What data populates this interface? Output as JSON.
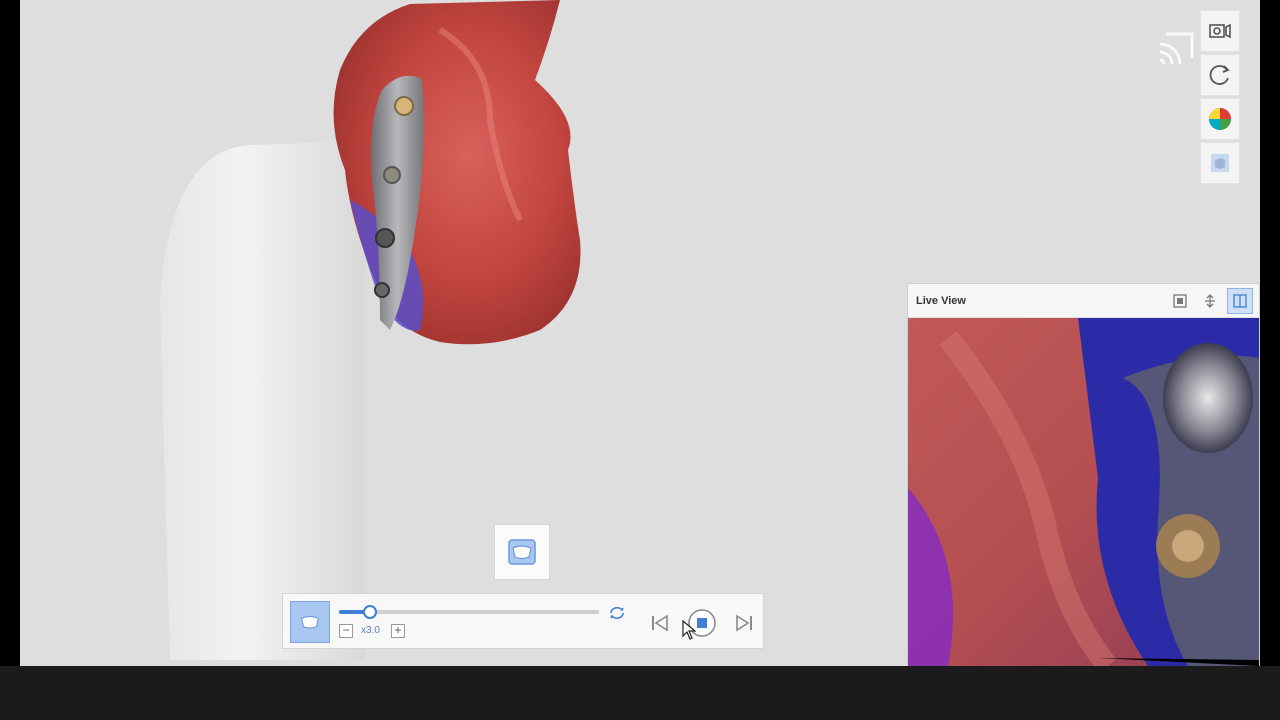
{
  "live_view": {
    "title": "Live View"
  },
  "playback": {
    "speed_label": "x3.0",
    "minus_label": "−",
    "plus_label": "+",
    "progress": 0.12
  },
  "icons": {
    "cast": "cast-icon",
    "camera_settings": "camera-settings-icon",
    "rotate": "rotate-icon",
    "color_map": "color-map-icon",
    "texture_box": "cube-icon",
    "scan_arch": "scan-arch-icon",
    "prev": "skip-back-icon",
    "stop": "stop-icon",
    "next": "skip-forward-icon",
    "loop": "loop-icon"
  },
  "colors": {
    "accent": "#3f7fd3",
    "active_button": "#a9c8f1",
    "canvas_bg": "#dedede"
  }
}
